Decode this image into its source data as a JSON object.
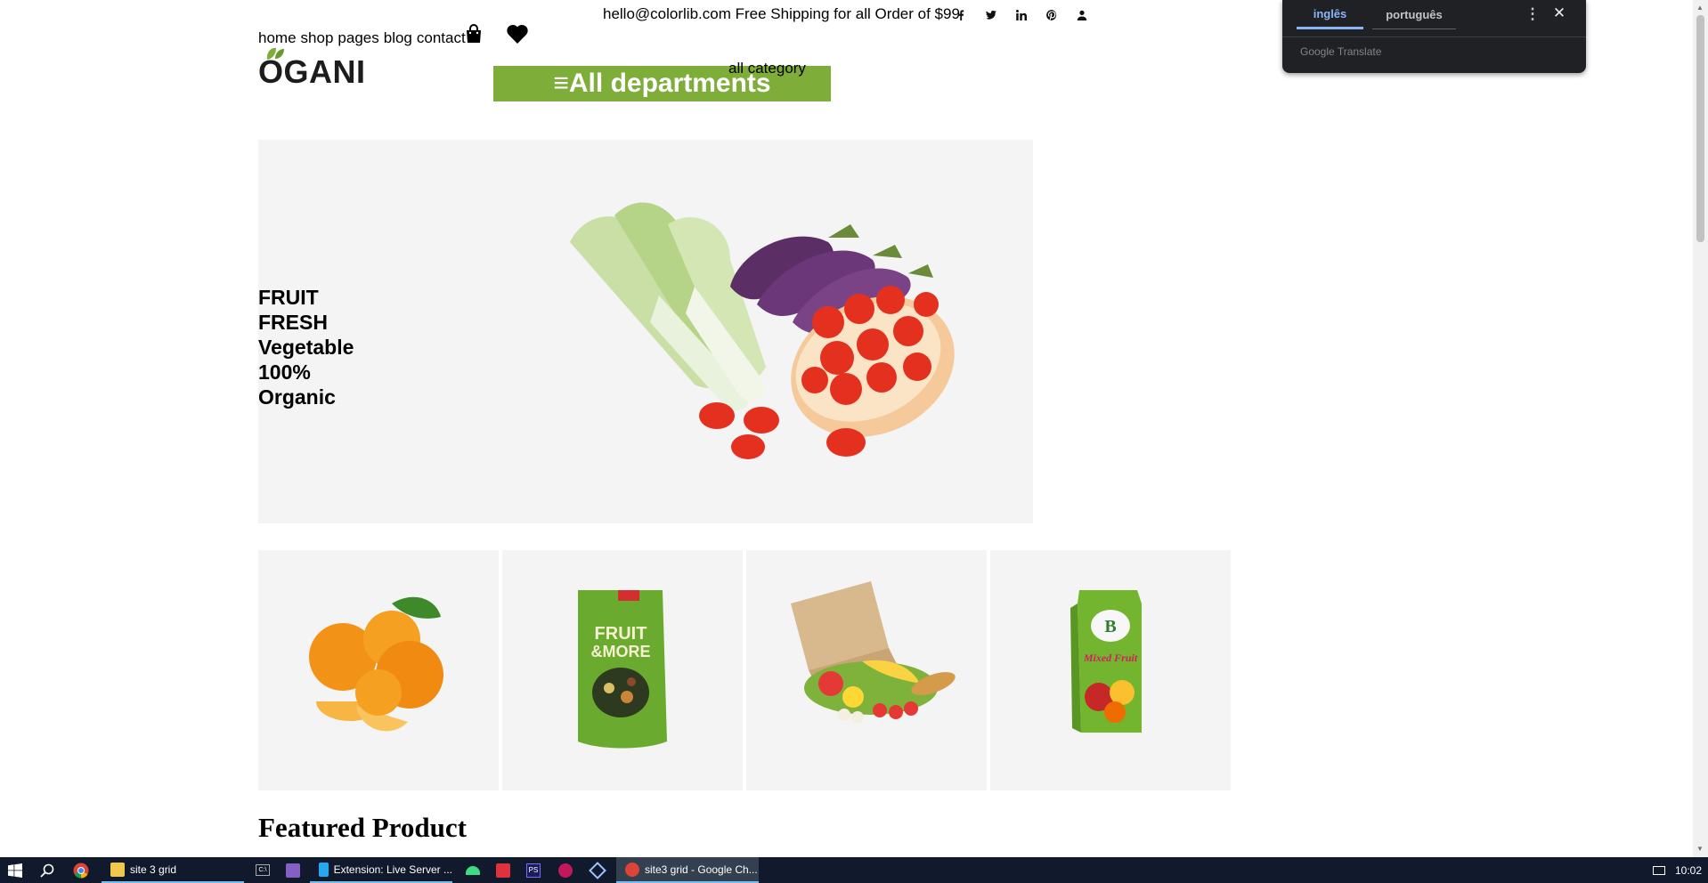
{
  "topbar": {
    "email": "hello@colorlib.com",
    "shipping": "Free Shipping for all Order of $99",
    "social": [
      "facebook-icon",
      "twitter-icon",
      "linkedin-icon",
      "pinterest-icon",
      "user-icon"
    ]
  },
  "nav": {
    "items": [
      "home",
      "shop",
      "pages",
      "blog",
      "contact"
    ],
    "cart_icon": "shopping-bag-icon",
    "wishlist_icon": "heart-icon"
  },
  "logo": {
    "text": "OGANI"
  },
  "departments": {
    "label": "≡All departments"
  },
  "category_select": {
    "label": "all category"
  },
  "hero": {
    "lines": [
      "FRUIT",
      "FRESH",
      "Vegetable",
      "100%",
      "Organic"
    ]
  },
  "categories": [
    "oranges",
    "fruit-and-more-snack-bag",
    "grocery-bag",
    "mixed-fruit-juice-box"
  ],
  "featured": {
    "title": "Featured Product"
  },
  "translate_popup": {
    "tab_source": "inglês",
    "tab_target": "português",
    "brand": "Google Translate",
    "colors": {
      "bg": "#202124",
      "accent": "#8ab4f8"
    }
  },
  "taskbar": {
    "items": [
      {
        "label": "site 3 grid",
        "icon": "folder-icon"
      },
      {
        "label": "Extension: Live Server ...",
        "icon": "vscode-icon"
      },
      {
        "label": "site3 grid - Google Ch...",
        "icon": "chrome-icon"
      }
    ],
    "clock": "10:02"
  },
  "colors": {
    "accent_green": "#7fad39",
    "hero_bg": "#f4f4f4"
  }
}
